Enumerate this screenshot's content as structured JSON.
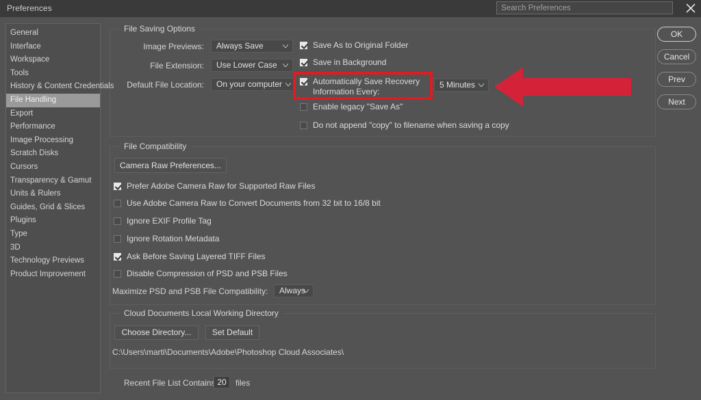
{
  "window": {
    "title": "Preferences",
    "close_icon": "close-icon"
  },
  "search": {
    "placeholder": "Search Preferences",
    "value": ""
  },
  "sidebar": {
    "items": [
      {
        "label": "General",
        "selected": false
      },
      {
        "label": "Interface",
        "selected": false
      },
      {
        "label": "Workspace",
        "selected": false
      },
      {
        "label": "Tools",
        "selected": false
      },
      {
        "label": "History & Content Credentials",
        "selected": false
      },
      {
        "label": "File Handling",
        "selected": true
      },
      {
        "label": "Export",
        "selected": false
      },
      {
        "label": "Performance",
        "selected": false
      },
      {
        "label": "Image Processing",
        "selected": false
      },
      {
        "label": "Scratch Disks",
        "selected": false
      },
      {
        "label": "Cursors",
        "selected": false
      },
      {
        "label": "Transparency & Gamut",
        "selected": false
      },
      {
        "label": "Units & Rulers",
        "selected": false
      },
      {
        "label": "Guides, Grid & Slices",
        "selected": false
      },
      {
        "label": "Plugins",
        "selected": false
      },
      {
        "label": "Type",
        "selected": false
      },
      {
        "label": "3D",
        "selected": false
      },
      {
        "label": "Technology Previews",
        "selected": false
      },
      {
        "label": "Product Improvement",
        "selected": false
      }
    ]
  },
  "file_saving_options": {
    "group_title": "File Saving Options",
    "image_previews_label": "Image Previews:",
    "image_previews_value": "Always Save",
    "file_extension_label": "File Extension:",
    "file_extension_value": "Use Lower Case",
    "default_file_location_label": "Default File Location:",
    "default_file_location_value": "On your computer",
    "save_as_original_folder": "Save As to Original Folder",
    "save_in_background": "Save in Background",
    "auto_save_recovery_line1": "Automatically Save Recovery",
    "auto_save_recovery_line2": "Information Every:",
    "auto_save_interval_value": "5 Minutes",
    "enable_legacy_save_as": "Enable legacy \"Save As\"",
    "do_not_append_copy": "Do not append \"copy\" to filename when saving a copy"
  },
  "file_compatibility": {
    "group_title": "File Compatibility",
    "camera_raw_preferences_button": "Camera Raw Preferences...",
    "prefer_acr": "Prefer Adobe Camera Raw for Supported Raw Files",
    "use_acr_convert": "Use Adobe Camera Raw to Convert Documents from 32 bit to 16/8 bit",
    "ignore_exif": "Ignore EXIF Profile Tag",
    "ignore_rotation": "Ignore Rotation Metadata",
    "ask_before_tiff": "Ask Before Saving Layered TIFF Files",
    "disable_compression": "Disable Compression of PSD and PSB Files",
    "maximize_label": "Maximize PSD and PSB File Compatibility:",
    "maximize_value": "Always"
  },
  "cloud_documents": {
    "group_title": "Cloud Documents Local Working Directory",
    "choose_directory_button": "Choose Directory...",
    "set_default_button": "Set Default",
    "path": "C:\\Users\\marti\\Documents\\Adobe\\Photoshop Cloud Associates\\"
  },
  "recent_files": {
    "label": "Recent File List Contains:",
    "value": "20",
    "suffix": "files"
  },
  "action_buttons": {
    "ok": "OK",
    "cancel": "Cancel",
    "prev": "Prev",
    "next": "Next"
  },
  "annotation": {
    "highlight_color": "#e01b22",
    "arrow_direction": "left",
    "arrow_icon": "left-arrow-annotation-icon"
  }
}
